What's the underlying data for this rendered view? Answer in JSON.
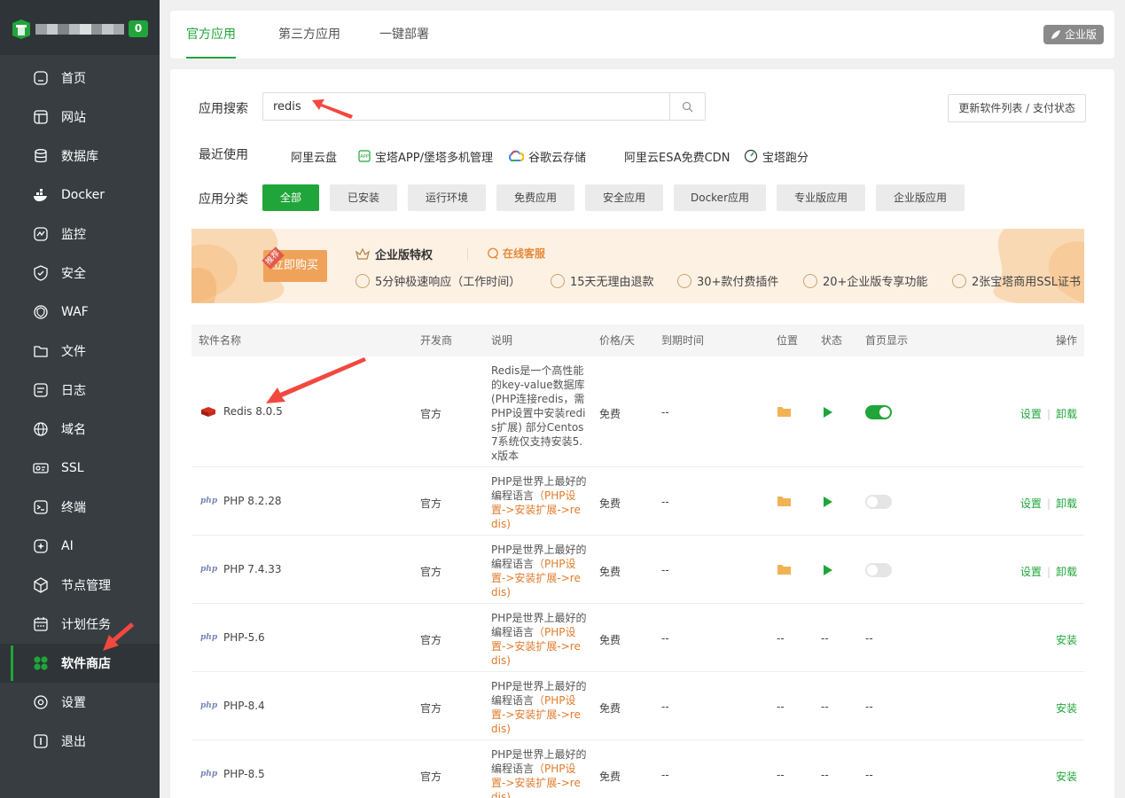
{
  "brand": {
    "badge": "0"
  },
  "sidebar": {
    "items": [
      {
        "label": "首页",
        "icon": "home-icon"
      },
      {
        "label": "网站",
        "icon": "website-icon"
      },
      {
        "label": "数据库",
        "icon": "database-icon"
      },
      {
        "label": "Docker",
        "icon": "docker-icon"
      },
      {
        "label": "监控",
        "icon": "monitor-icon"
      },
      {
        "label": "安全",
        "icon": "shield-icon"
      },
      {
        "label": "WAF",
        "icon": "waf-icon"
      },
      {
        "label": "文件",
        "icon": "folder-icon"
      },
      {
        "label": "日志",
        "icon": "log-icon"
      },
      {
        "label": "域名",
        "icon": "globe-icon"
      },
      {
        "label": "SSL",
        "icon": "ssl-icon"
      },
      {
        "label": "终端",
        "icon": "terminal-icon"
      },
      {
        "label": "AI",
        "icon": "ai-icon"
      },
      {
        "label": "节点管理",
        "icon": "node-icon"
      },
      {
        "label": "计划任务",
        "icon": "calendar-icon"
      },
      {
        "label": "软件商店",
        "icon": "app-store-icon",
        "active": true
      },
      {
        "label": "设置",
        "icon": "gear-icon"
      },
      {
        "label": "退出",
        "icon": "logout-icon"
      }
    ]
  },
  "tabs": [
    {
      "label": "官方应用",
      "active": true
    },
    {
      "label": "第三方应用"
    },
    {
      "label": "一键部署"
    }
  ],
  "enterprise_badge": "企业版",
  "search": {
    "label": "应用搜索",
    "value": "redis",
    "placeholder": ""
  },
  "update_button": "更新软件列表 / 支付状态",
  "recent": {
    "label": "最近使用",
    "items": [
      "阿里云盘",
      "宝塔APP/堡塔多机管理",
      "谷歌云存储",
      "阿里云ESA免费CDN",
      "宝塔跑分"
    ]
  },
  "categories": {
    "label": "应用分类",
    "items": [
      "全部",
      "已安装",
      "运行环境",
      "免费应用",
      "安全应用",
      "Docker应用",
      "专业版应用",
      "企业版应用"
    ],
    "active_index": 0
  },
  "banner": {
    "buy_button": "立即购买",
    "tag": "推荐",
    "title": "企业版特权",
    "service": "在线客服",
    "features": [
      "5分钟极速响应（工作时间）",
      "15天无理由退款",
      "30+款付费插件",
      "20+企业版专享功能",
      "2张宝塔商用SSL证书"
    ]
  },
  "table": {
    "headers": {
      "name": "软件名称",
      "developer": "开发商",
      "desc": "说明",
      "price": "价格/天",
      "expire": "到期时间",
      "location": "位置",
      "status": "状态",
      "home": "首页显示",
      "ops": "操作"
    },
    "rows": [
      {
        "name": "Redis 8.0.5",
        "logo": "redis-icon",
        "developer": "官方",
        "desc": "Redis是一个高性能的key-value数据库(PHP连接redis，需PHP设置中安装redis扩展) 部分Centos7系统仅支持安装5.x版本",
        "desc_hl": "",
        "price": "免费",
        "expire": "--",
        "installed": true,
        "home_on": true,
        "ops": [
          "设置",
          "卸载"
        ]
      },
      {
        "name": "PHP 8.2.28",
        "logo": "php-icon",
        "developer": "官方",
        "desc": "PHP是世界上最好的编程语言",
        "desc_hl": "（PHP设置->安装扩展->redis)",
        "price": "免费",
        "expire": "--",
        "installed": true,
        "home_on": false,
        "ops": [
          "设置",
          "卸载"
        ]
      },
      {
        "name": "PHP 7.4.33",
        "logo": "php-icon",
        "developer": "官方",
        "desc": "PHP是世界上最好的编程语言",
        "desc_hl": "（PHP设置->安装扩展->redis)",
        "price": "免费",
        "expire": "--",
        "installed": true,
        "home_on": false,
        "ops": [
          "设置",
          "卸载"
        ]
      },
      {
        "name": "PHP-5.6",
        "logo": "php-icon",
        "developer": "官方",
        "desc": "PHP是世界上最好的编程语言",
        "desc_hl": "（PHP设置->安装扩展->redis)",
        "price": "免费",
        "expire": "--",
        "installed": false,
        "placeholder": "--",
        "ops": [
          "安装"
        ]
      },
      {
        "name": "PHP-8.4",
        "logo": "php-icon",
        "developer": "官方",
        "desc": "PHP是世界上最好的编程语言",
        "desc_hl": "（PHP设置->安装扩展->redis)",
        "price": "免费",
        "expire": "--",
        "installed": false,
        "placeholder": "--",
        "ops": [
          "安装"
        ]
      },
      {
        "name": "PHP-8.5",
        "logo": "php-icon",
        "developer": "官方",
        "desc": "PHP是世界上最好的编程语言",
        "desc_hl": "（PHP设置->安装扩展->redis)",
        "price": "免费",
        "expire": "--",
        "installed": false,
        "placeholder": "--",
        "ops": [
          "安装"
        ]
      }
    ]
  },
  "colors": {
    "accent": "#20a53a",
    "sidebar_bg": "#373d41",
    "highlight_text": "#e07b2c",
    "annotation": "#f2483f"
  }
}
